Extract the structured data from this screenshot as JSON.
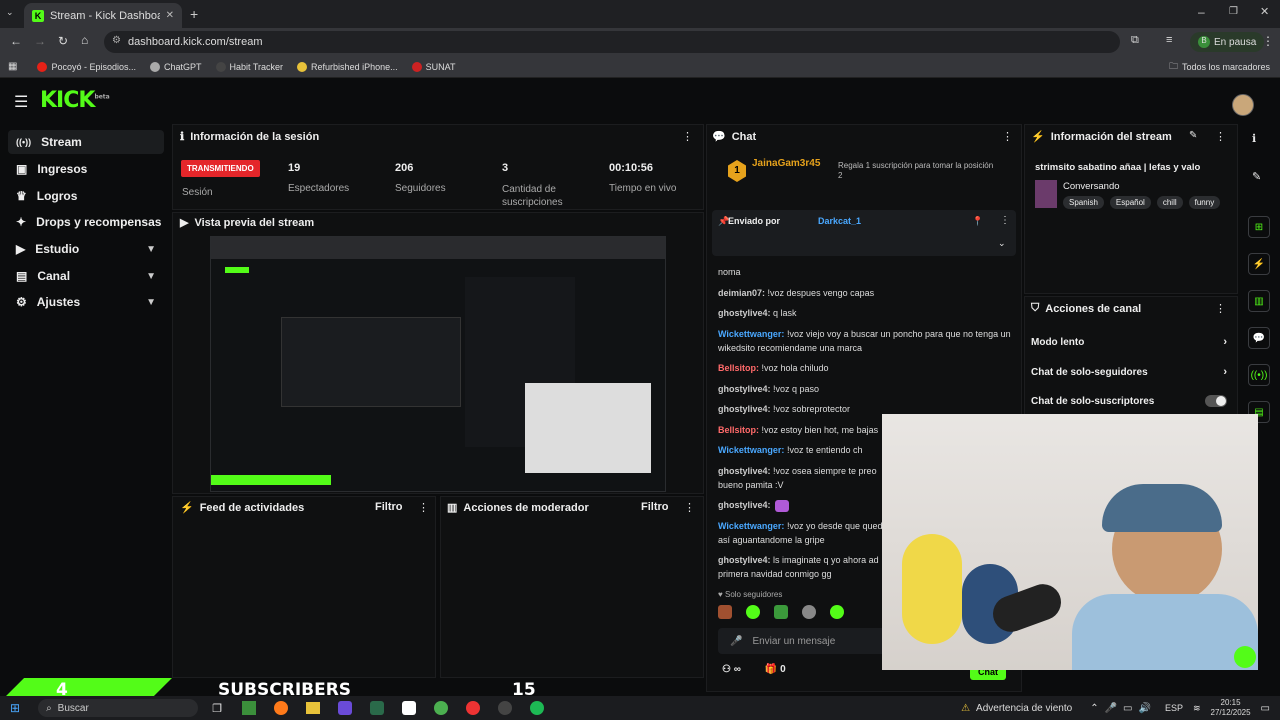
{
  "browser": {
    "tab_title": "Stream - Kick Dashboard",
    "url": "dashboard.kick.com/stream",
    "profile_status": "En pausa",
    "bookmarks": [
      "Pocoyó - Episodios...",
      "ChatGPT",
      "Habit Tracker",
      "Refurbished iPhone...",
      "SUNAT"
    ],
    "all_bookmarks": "Todos los marcadores"
  },
  "app": {
    "logo": "KICK",
    "logo_badge": "beta"
  },
  "sidebar": {
    "items": [
      {
        "label": "Stream"
      },
      {
        "label": "Ingresos"
      },
      {
        "label": "Logros"
      },
      {
        "label": "Drops y recompensas"
      },
      {
        "label": "Estudio"
      },
      {
        "label": "Canal"
      },
      {
        "label": "Ajustes"
      }
    ]
  },
  "session": {
    "title": "Información de la sesión",
    "live_badge": "TRANSMITIENDO",
    "live_label": "Sesión",
    "viewers": "19",
    "viewers_label": "Espectadores",
    "followers": "206",
    "followers_label": "Seguidores",
    "subs": "3",
    "subs_label": "Cantidad de suscripciones",
    "uptime": "00:10:56",
    "uptime_label": "Tiempo en vivo"
  },
  "preview": {
    "title": "Vista previa del stream"
  },
  "feed": {
    "title": "Feed de actividades",
    "filter": "Filtro"
  },
  "modactions": {
    "title": "Acciones de moderador",
    "filter": "Filtro"
  },
  "chat": {
    "title": "Chat",
    "gifter": "JainaGam3r45",
    "gifter_count": "1",
    "gift_text": "Regala 1 suscripción para tomar la posición 2",
    "pinned_label": "Enviado por",
    "pinned_user": "Darkcat_1",
    "messages": [
      {
        "user": "",
        "text": "noma"
      },
      {
        "user": "deimian07:",
        "text": " !voz despues vengo capas"
      },
      {
        "user": "ghostylive4:",
        "text": " q lask"
      },
      {
        "user": "Wickettwanger:",
        "text": " !voz viejo voy a buscar un poncho para que no tenga un wikedsito recomiendame una marca"
      },
      {
        "user": "Bellsitop:",
        "text": " !voz hola chiludo"
      },
      {
        "user": "ghostylive4:",
        "text": " !voz q paso"
      },
      {
        "user": "ghostylive4:",
        "text": " !voz sobreprotector"
      },
      {
        "user": "Bellsitop:",
        "text": " !voz estoy bien hot, me bajas"
      },
      {
        "user": "Wickettwanger:",
        "text": " !voz te entiendo ch"
      },
      {
        "user": "ghostylive4:",
        "text": " !voz osea siempre te preo bueno pamita :V"
      },
      {
        "user": "ghostylive4:",
        "text": ""
      },
      {
        "user": "Wickettwanger:",
        "text": " !voz yo desde que quedo así aguantandome la gripe"
      },
      {
        "user": "ghostylive4:",
        "text": " ls imaginate q yo ahora ad primera navidad conmigo gg"
      }
    ],
    "followers_only": "Solo seguidores",
    "input_placeholder": "Enviar un mensaje",
    "infinite": "∞",
    "gifts": "0",
    "send": "Chat"
  },
  "stream_info": {
    "title": "Información del stream",
    "stream_title": "strimsito sabatino añaa | lefas y valo",
    "category": "Conversando",
    "tags": [
      "Spanish",
      "Español",
      "chill",
      "funny"
    ]
  },
  "channel_actions": {
    "title": "Acciones de canal",
    "items": [
      {
        "label": "Modo lento"
      },
      {
        "label": "Chat de solo-seguidores"
      },
      {
        "label": "Chat de solo-suscriptores"
      }
    ]
  },
  "overlay": {
    "count": "4",
    "label": "SUBSCRIBERS",
    "goal": "15"
  },
  "taskbar": {
    "search": "Buscar",
    "weather": "Advertencia de viento",
    "lang": "ESP",
    "time": "20:15",
    "date": "27/12/2025"
  },
  "colors": {
    "accent": "#53fc18",
    "live": "#e4262a",
    "panel": "#0f1011"
  }
}
